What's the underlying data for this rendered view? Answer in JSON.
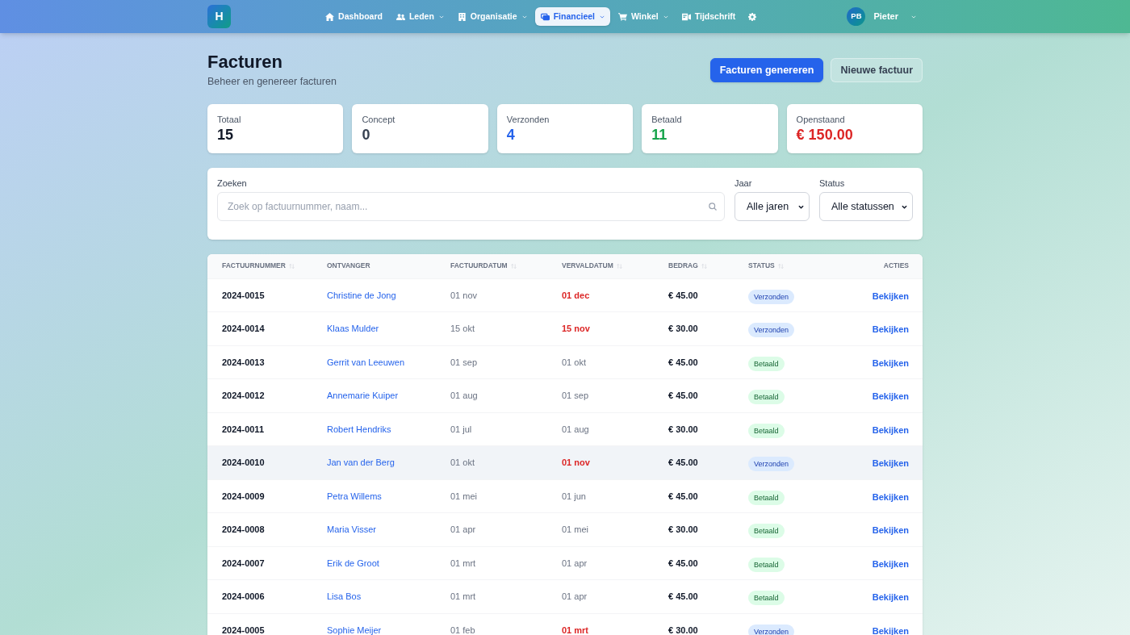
{
  "header": {
    "logo": "H",
    "nav": [
      {
        "label": "Dashboard",
        "dropdown": false,
        "selected": false
      },
      {
        "label": "Leden",
        "dropdown": true,
        "selected": false
      },
      {
        "label": "Organisatie",
        "dropdown": true,
        "selected": false
      },
      {
        "label": "Financieel",
        "dropdown": true,
        "selected": true
      },
      {
        "label": "Winkel",
        "dropdown": true,
        "selected": false
      },
      {
        "label": "Tijdschrift",
        "dropdown": false,
        "selected": false
      }
    ],
    "user": {
      "initials": "PB",
      "name": "Pieter"
    }
  },
  "page": {
    "title": "Facturen",
    "subtitle": "Beheer en genereer facturen",
    "buttons": [
      {
        "label": "Facturen genereren",
        "kind": "primary"
      },
      {
        "label": "Nieuwe factuur",
        "kind": "secondary"
      }
    ]
  },
  "stats": [
    {
      "label": "Totaal",
      "value": "15",
      "color": "#111827"
    },
    {
      "label": "Concept",
      "value": "0",
      "color": "#374151"
    },
    {
      "label": "Verzonden",
      "value": "4",
      "color": "#2563eb"
    },
    {
      "label": "Betaald",
      "value": "11",
      "color": "#16a34a"
    },
    {
      "label": "Openstaand",
      "value": "€ 150.00",
      "color": "#dc2626"
    }
  ],
  "filters": {
    "search": {
      "label": "Zoeken",
      "placeholder": "Zoek op factuurnummer, naam..."
    },
    "year": {
      "label": "Jaar",
      "value": "Alle jaren"
    },
    "status": {
      "label": "Status",
      "value": "Alle statussen"
    }
  },
  "table": {
    "columns": [
      {
        "label": "FACTUURNUMMER",
        "sortable": true
      },
      {
        "label": "ONTVANGER",
        "sortable": false
      },
      {
        "label": "FACTUURDATUM",
        "sortable": true
      },
      {
        "label": "VERVALDATUM",
        "sortable": true
      },
      {
        "label": "BEDRAG",
        "sortable": true
      },
      {
        "label": "STATUS",
        "sortable": true
      },
      {
        "label": "ACTIES",
        "sortable": false
      }
    ],
    "rows": [
      {
        "number": "2024-0015",
        "recipient": "Christine de Jong",
        "invoice_date": "01 nov",
        "due_date": "01 dec",
        "overdue": true,
        "amount": "€ 45.00",
        "status": {
          "label": "Verzonden",
          "kind": "sent"
        },
        "action": "Bekijken",
        "highlighted": false
      },
      {
        "number": "2024-0014",
        "recipient": "Klaas Mulder",
        "invoice_date": "15 okt",
        "due_date": "15 nov",
        "overdue": true,
        "amount": "€ 30.00",
        "status": {
          "label": "Verzonden",
          "kind": "sent"
        },
        "action": "Bekijken",
        "highlighted": false
      },
      {
        "number": "2024-0013",
        "recipient": "Gerrit van Leeuwen",
        "invoice_date": "01 sep",
        "due_date": "01 okt",
        "overdue": false,
        "amount": "€ 45.00",
        "status": {
          "label": "Betaald",
          "kind": "paid"
        },
        "action": "Bekijken",
        "highlighted": false
      },
      {
        "number": "2024-0012",
        "recipient": "Annemarie Kuiper",
        "invoice_date": "01 aug",
        "due_date": "01 sep",
        "overdue": false,
        "amount": "€ 45.00",
        "status": {
          "label": "Betaald",
          "kind": "paid"
        },
        "action": "Bekijken",
        "highlighted": false
      },
      {
        "number": "2024-0011",
        "recipient": "Robert Hendriks",
        "invoice_date": "01 jul",
        "due_date": "01 aug",
        "overdue": false,
        "amount": "€ 30.00",
        "status": {
          "label": "Betaald",
          "kind": "paid"
        },
        "action": "Bekijken",
        "highlighted": false
      },
      {
        "number": "2024-0010",
        "recipient": "Jan van der Berg",
        "invoice_date": "01 okt",
        "due_date": "01 nov",
        "overdue": true,
        "amount": "€ 45.00",
        "status": {
          "label": "Verzonden",
          "kind": "sent"
        },
        "action": "Bekijken",
        "highlighted": true
      },
      {
        "number": "2024-0009",
        "recipient": "Petra Willems",
        "invoice_date": "01 mei",
        "due_date": "01 jun",
        "overdue": false,
        "amount": "€ 45.00",
        "status": {
          "label": "Betaald",
          "kind": "paid"
        },
        "action": "Bekijken",
        "highlighted": false
      },
      {
        "number": "2024-0008",
        "recipient": "Maria Visser",
        "invoice_date": "01 apr",
        "due_date": "01 mei",
        "overdue": false,
        "amount": "€ 30.00",
        "status": {
          "label": "Betaald",
          "kind": "paid"
        },
        "action": "Bekijken",
        "highlighted": false
      },
      {
        "number": "2024-0007",
        "recipient": "Erik de Groot",
        "invoice_date": "01 mrt",
        "due_date": "01 apr",
        "overdue": false,
        "amount": "€ 45.00",
        "status": {
          "label": "Betaald",
          "kind": "paid"
        },
        "action": "Bekijken",
        "highlighted": false
      },
      {
        "number": "2024-0006",
        "recipient": "Lisa Bos",
        "invoice_date": "01 mrt",
        "due_date": "01 apr",
        "overdue": false,
        "amount": "€ 45.00",
        "status": {
          "label": "Betaald",
          "kind": "paid"
        },
        "action": "Bekijken",
        "highlighted": false
      },
      {
        "number": "2024-0005",
        "recipient": "Sophie Meijer",
        "invoice_date": "01 feb",
        "due_date": "01 mrt",
        "overdue": true,
        "amount": "€ 30.00",
        "status": {
          "label": "Verzonden",
          "kind": "sent"
        },
        "action": "Bekijken",
        "highlighted": false
      }
    ]
  }
}
